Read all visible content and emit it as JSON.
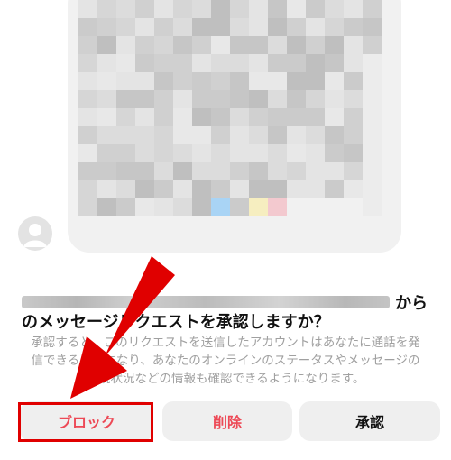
{
  "dialog": {
    "title_suffix": "から",
    "title_line2": "のメッセージリクエストを承認しますか？",
    "description": "承認すると、このリクエストを送信したアカウントはあなたに通話を発信できるようになり、あなたのオンラインのステータスやメッセージの既読状況などの情報も確認できるようになります。"
  },
  "buttons": {
    "block": "ブロック",
    "delete": "削除",
    "accept": "承認"
  },
  "colors": {
    "danger": "#ed4956",
    "annotation": "#e00000",
    "button_bg": "#efefef"
  },
  "icons": {
    "avatar": "default-avatar-icon",
    "annotation": "red-arrow"
  }
}
